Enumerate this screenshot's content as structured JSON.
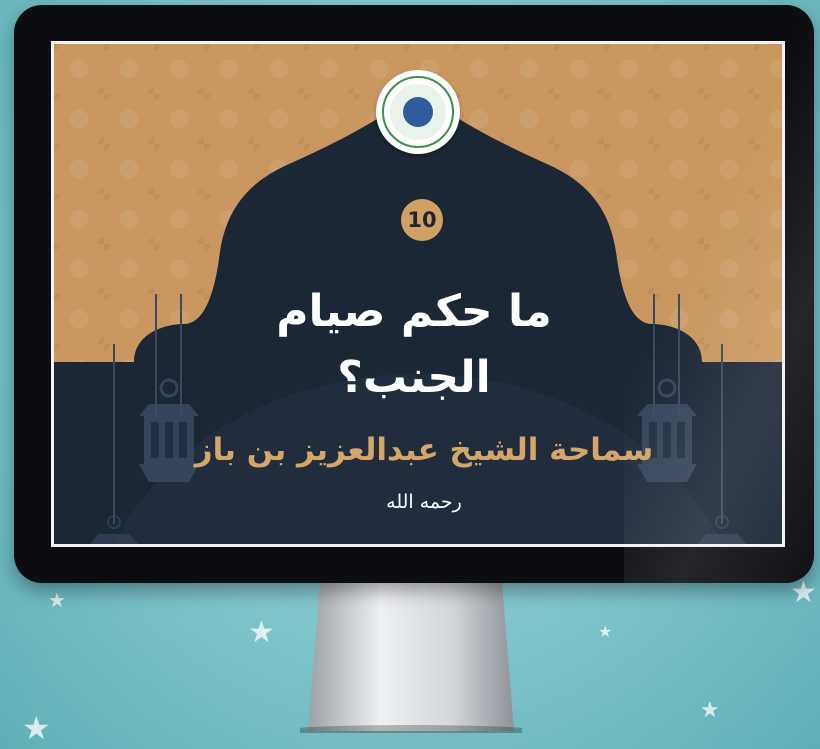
{
  "background": {
    "color": "#7cc3c8"
  },
  "monitor": {
    "bezel_color": "#0c0d10"
  },
  "screen": {
    "logo": {
      "icon": "circular-seal-logo-icon"
    },
    "number_badge": "10",
    "title_line1": "ما حكم صيام",
    "title_line2": "الجنب؟",
    "speaker": "سماحة الشيخ عبدالعزيز بن باز",
    "dua": "رحمه الله",
    "colors": {
      "tan": "#c9975f",
      "navy": "#1c2736",
      "gold_text": "#d5a66a"
    }
  }
}
